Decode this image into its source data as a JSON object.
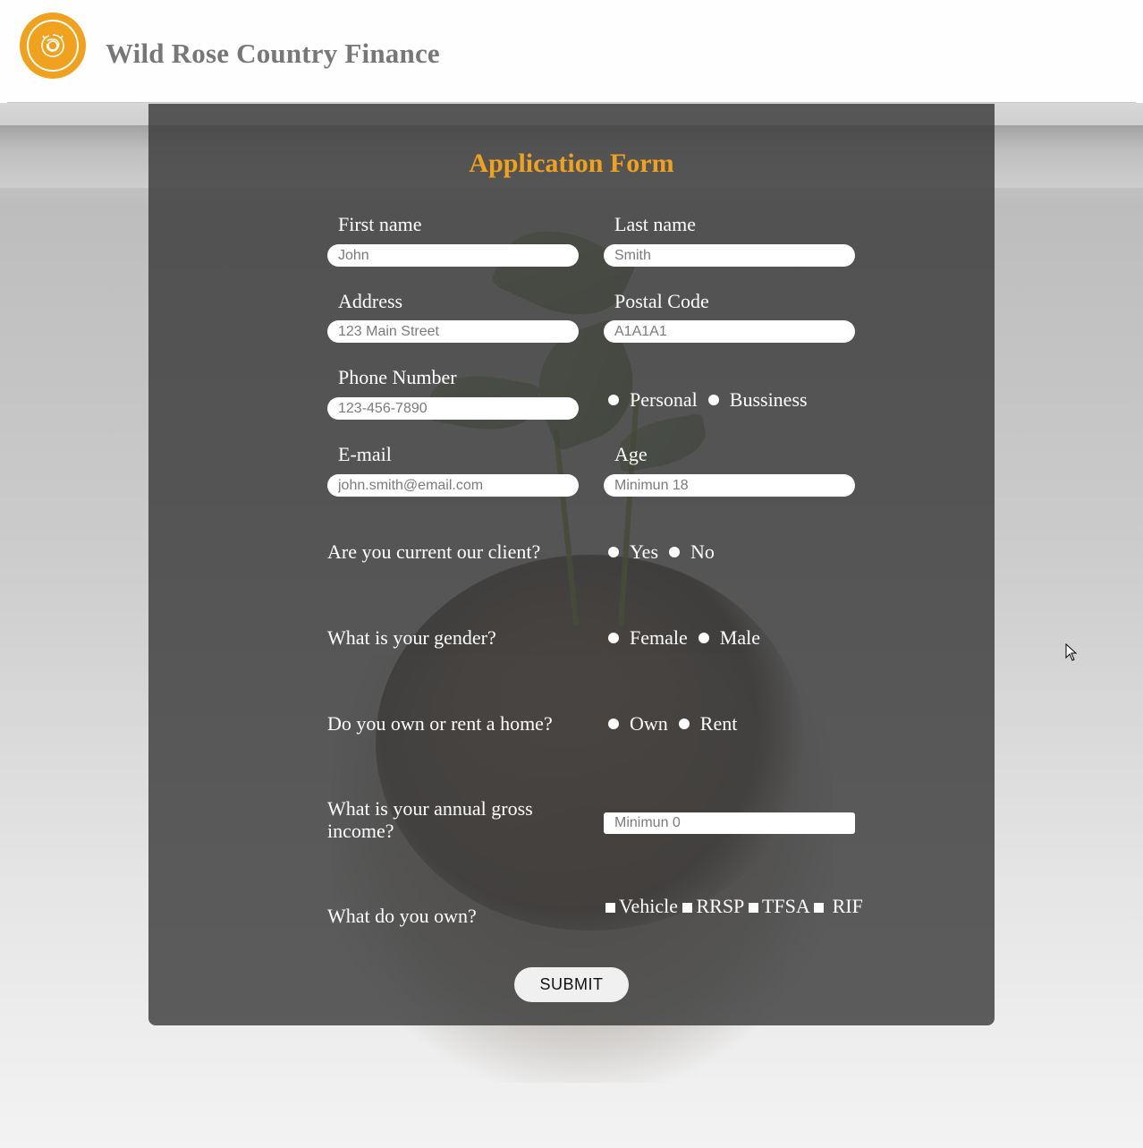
{
  "brand": {
    "name": "Wild Rose Country Finance",
    "logo_icon": "rose-logo-icon",
    "accent": "#f0a21e"
  },
  "form": {
    "title": "Application Form",
    "first_name": {
      "label": "First name",
      "placeholder": "John"
    },
    "last_name": {
      "label": "Last name",
      "placeholder": "Smith"
    },
    "address": {
      "label": "Address",
      "placeholder": "123 Main Street"
    },
    "postal_code": {
      "label": "Postal Code",
      "placeholder": "A1A1A1"
    },
    "phone": {
      "label": "Phone Number",
      "placeholder": "123-456-7890"
    },
    "account_type": {
      "options": [
        "Personal",
        "Bussiness"
      ]
    },
    "email": {
      "label": "E-mail",
      "placeholder": "john.smith@email.com"
    },
    "age": {
      "label": "Age",
      "placeholder": "Minimun 18"
    },
    "current_client": {
      "question": "Are you current our client?",
      "options": [
        "Yes",
        "No"
      ]
    },
    "gender": {
      "question": "What is your gender?",
      "options": [
        "Female",
        "Male"
      ]
    },
    "home": {
      "question": "Do you own or rent a home?",
      "options": [
        "Own",
        "Rent"
      ]
    },
    "income": {
      "question": "What is your annual gross income?",
      "placeholder": "Minimun 0"
    },
    "assets": {
      "question": "What do you own?",
      "options": [
        "Vehicle",
        "RRSP",
        "TFSA",
        "RIF"
      ]
    },
    "submit_label": "SUBMIT"
  }
}
